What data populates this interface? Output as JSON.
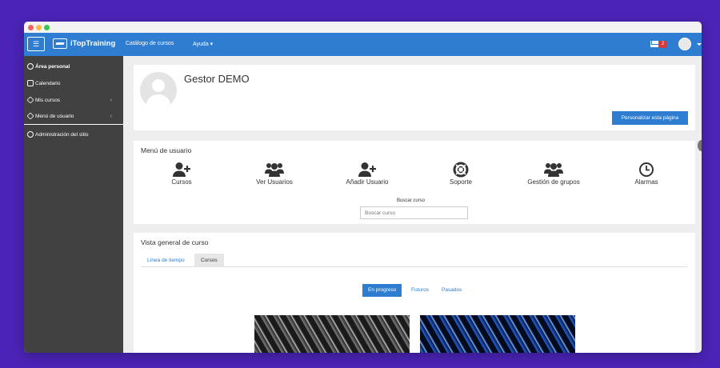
{
  "navbar": {
    "brand": "iTopTraining",
    "menu_catalog": "Catálogo de cursos",
    "menu_help": "Ayuda ▾",
    "message_count": "2"
  },
  "sidebar": {
    "items": [
      {
        "label": "Área personal"
      },
      {
        "label": "Calendario"
      },
      {
        "label": "Mis cursos"
      },
      {
        "label": "Menú de usuario"
      },
      {
        "label": "Administración del sitio"
      }
    ]
  },
  "profile": {
    "name": "Gestor DEMO",
    "customize_button": "Personalizar esta página"
  },
  "user_menu": {
    "title": "Menú de usuario",
    "items": [
      {
        "label": "Cursos",
        "icon": "user-plus-icon"
      },
      {
        "label": "Ver Usuarios",
        "icon": "users-icon"
      },
      {
        "label": "Añadir Usuario",
        "icon": "user-plus-icon"
      },
      {
        "label": "Soporte",
        "icon": "life-ring-icon"
      },
      {
        "label": "Gestión de grupos",
        "icon": "users-icon"
      },
      {
        "label": "Alarmas",
        "icon": "clock-icon"
      }
    ],
    "search_label": "Buscar curso",
    "search_placeholder": "Buscar curso"
  },
  "course_overview": {
    "title": "Vista general de curso",
    "tabs": [
      {
        "label": "Línea de tiempo"
      },
      {
        "label": "Cursos"
      }
    ],
    "filters": [
      {
        "label": "En progreso"
      },
      {
        "label": "Futuros"
      },
      {
        "label": "Pasados"
      }
    ]
  },
  "colors": {
    "accent": "#2e7dd1",
    "sidebar": "#414141",
    "badge": "#d9383a"
  }
}
